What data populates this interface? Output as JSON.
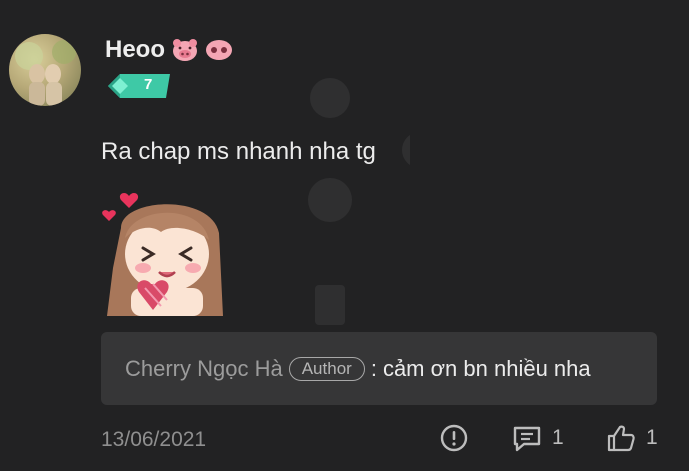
{
  "comment": {
    "username": "Heoo",
    "level": "7",
    "text": "Ra chap ms nhanh nha tg",
    "date": "13/06/2021"
  },
  "reply": {
    "author": "Cherry Ngọc Hà",
    "author_tag": "Author",
    "separator": ":",
    "text": "cảm ơn bn nhiều nha"
  },
  "actions": {
    "reply_count": "1",
    "like_count": "1"
  },
  "icons": {
    "report": "alert-circle-icon",
    "reply": "message-square-icon",
    "like": "thumbs-up-icon",
    "badge": "level-badge-icon",
    "emoji": "pig-face-icon"
  },
  "colors": {
    "background": "#222223",
    "reply_background": "#363637",
    "badge_green": "#3ec9a6",
    "secondary_text": "#8f8f8f"
  }
}
